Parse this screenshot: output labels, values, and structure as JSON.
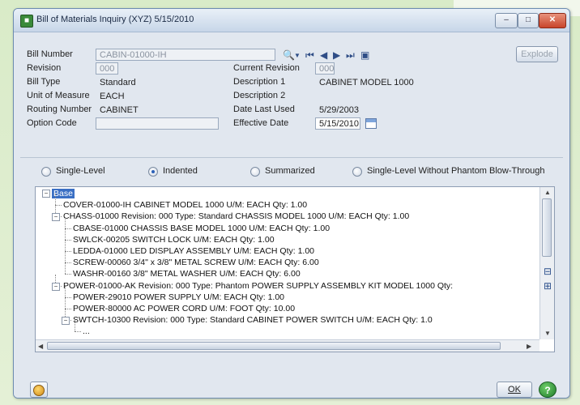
{
  "window": {
    "title": "Bill of Materials Inquiry (XYZ) 5/15/2010",
    "minimize": "–",
    "maximize": "□",
    "close": "✕"
  },
  "header": {
    "bill_number_label": "Bill Number",
    "bill_number_value": "CABIN-01000-IH",
    "revision_label": "Revision",
    "revision_value": "000",
    "bill_type_label": "Bill Type",
    "bill_type_value": "Standard",
    "uom_label": "Unit of Measure",
    "uom_value": "EACH",
    "routing_label": "Routing Number",
    "routing_value": "CABINET",
    "option_code_label": "Option Code",
    "option_code_value": "",
    "current_revision_label": "Current Revision",
    "current_revision_value": "000",
    "description1_label": "Description 1",
    "description1_value": "CABINET MODEL 1000",
    "description2_label": "Description 2",
    "description2_value": "",
    "date_last_used_label": "Date Last Used",
    "date_last_used_value": "5/29/2003",
    "effective_date_label": "Effective Date",
    "effective_date_value": "5/15/2010",
    "explode_label": "Explode"
  },
  "view_options": {
    "options": [
      "Single-Level",
      "Indented",
      "Summarized",
      "Single-Level Without Phantom Blow-Through"
    ],
    "selected": "Indented"
  },
  "tree": {
    "root_label": "Base",
    "rows": [
      {
        "depth": 1,
        "text": "COVER-01000-IH    CABINET MODEL 1000    U/M: EACH    Qty: 1.00",
        "expandable": false
      },
      {
        "depth": 1,
        "text": "CHASS-01000    Revision: 000    Type: Standard    CHASSIS MODEL 1000    U/M: EACH    Qty: 1.00",
        "expandable": true
      },
      {
        "depth": 2,
        "text": "CBASE-01000    CHASSIS BASE MODEL 1000    U/M: EACH    Qty: 1.00",
        "expandable": false
      },
      {
        "depth": 2,
        "text": "SWLCK-00205    SWITCH LOCK    U/M: EACH    Qty: 1.00",
        "expandable": false
      },
      {
        "depth": 2,
        "text": "LEDDA-01000    LED DISPLAY ASSEMBLY    U/M: EACH    Qty: 1.00",
        "expandable": false
      },
      {
        "depth": 2,
        "text": "SCREW-00060    3/4\" x 3/8\" METAL SCREW    U/M: EACH    Qty: 6.00",
        "expandable": false
      },
      {
        "depth": 2,
        "text": "WASHR-00160    3/8\" METAL WASHER    U/M: EACH    Qty: 6.00",
        "expandable": false
      },
      {
        "depth": 1,
        "text": "POWER-01000-AK    Revision: 000    Type: Phantom    POWER SUPPLY ASSEMBLY KIT MODEL 1000    Qty:",
        "expandable": true
      },
      {
        "depth": 2,
        "text": "POWER-29010    POWER SUPPLY    U/M: EACH    Qty: 1.00",
        "expandable": false
      },
      {
        "depth": 2,
        "text": "POWER-80000    AC POWER CORD    U/M: FOOT    Qty: 10.00",
        "expandable": false
      },
      {
        "depth": 2,
        "text": "SWTCH-10300    Revision: 000    Type: Standard    CABINET POWER SWITCH    U/M: EACH    Qty: 1.0",
        "expandable": true
      },
      {
        "depth": 3,
        "text": "...",
        "expandable": false
      }
    ]
  },
  "footer": {
    "ok_label": "OK"
  }
}
